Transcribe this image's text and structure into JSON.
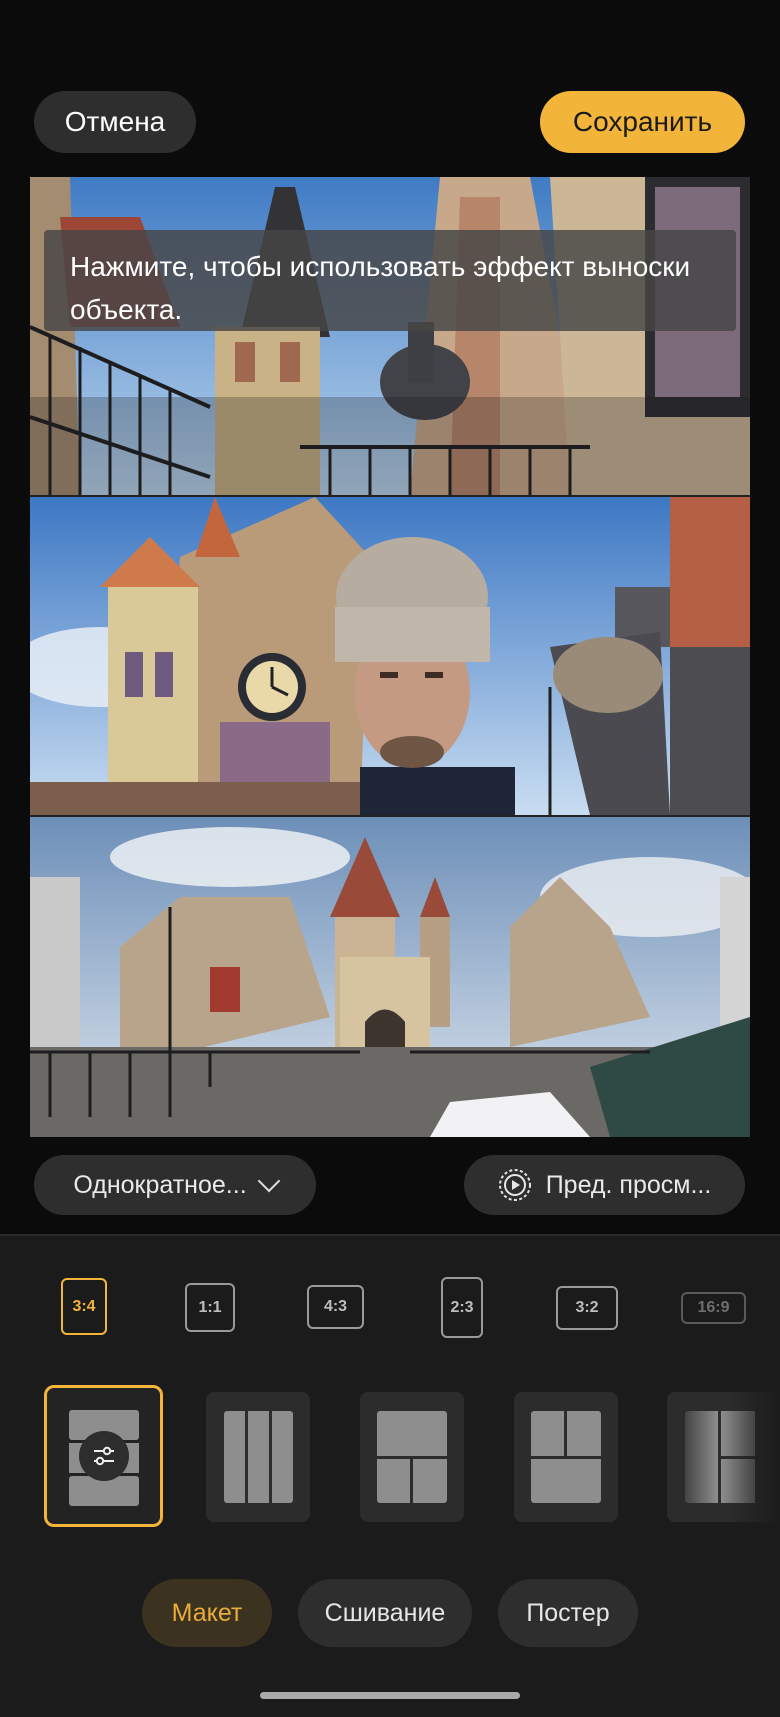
{
  "header": {
    "cancel_label": "Отмена",
    "save_label": "Сохранить"
  },
  "collage": {
    "hint_text": "Нажмите, чтобы использовать эффект выноски объекта."
  },
  "controls": {
    "mode_label": "Однократное...",
    "preview_label": "Пред. просм..."
  },
  "ratios": [
    {
      "label": "3:4",
      "selected": true
    },
    {
      "label": "1:1",
      "selected": false
    },
    {
      "label": "4:3",
      "selected": false
    },
    {
      "label": "2:3",
      "selected": false
    },
    {
      "label": "3:2",
      "selected": false
    },
    {
      "label": "16:9",
      "selected": false
    }
  ],
  "layouts": [
    "three-rows-with-adjust",
    "three-columns",
    "one-top-two-bottom",
    "two-top-one-bottom",
    "one-left-two-right"
  ],
  "tabs": [
    {
      "label": "Макет",
      "active": true
    },
    {
      "label": "Сшивание",
      "active": false
    },
    {
      "label": "Постер",
      "active": false
    }
  ],
  "colors": {
    "accent": "#f3b43a",
    "background": "#0b0b0b",
    "panel": "#1b1b1b",
    "button": "#2e2e2e"
  }
}
